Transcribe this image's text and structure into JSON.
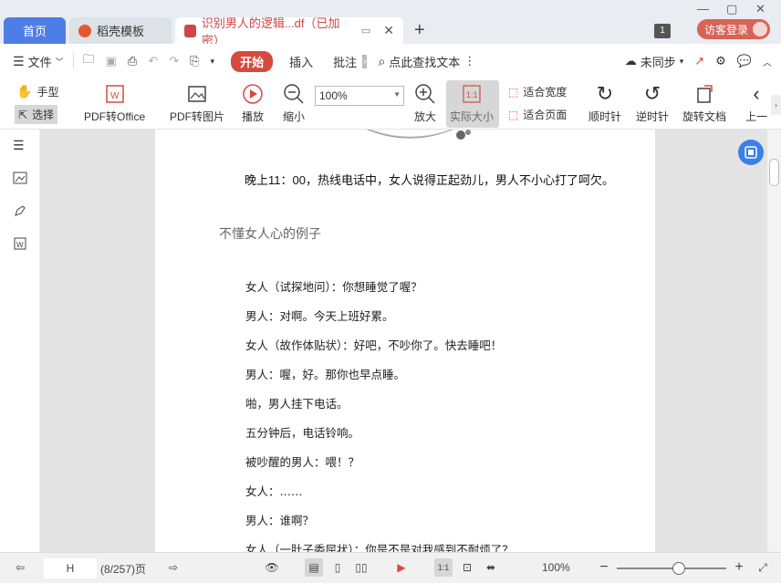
{
  "tabs": {
    "home": "首页",
    "template": "稻壳模板",
    "document": "识别男人的逻辑...df（已加密）",
    "page_count_badge": "1",
    "login": "访客登录"
  },
  "menu": {
    "file": "文件",
    "start": "开始",
    "insert": "插入",
    "annotate": "批注",
    "search": "点此查找文本",
    "sync": "未同步"
  },
  "ribbon": {
    "hand": "手型",
    "select": "选择",
    "pdf_to_office": "PDF转Office",
    "pdf_to_image": "PDF转图片",
    "play": "播放",
    "zoom_out": "缩小",
    "zoom_value": "100%",
    "zoom_in": "放大",
    "actual_size": "实际大小",
    "actual_size_icon": "1:1",
    "fit_width": "适合宽度",
    "fit_page": "适合页面",
    "rotate_cw": "顺时针",
    "rotate_ccw": "逆时针",
    "rotate_doc": "旋转文档",
    "prev": "上一"
  },
  "page": {
    "headline": "晚上11：00，热线电话中，女人说得正起劲儿，男人不小心打了呵欠。",
    "subtitle": "不懂女人心的例子",
    "lines": [
      "女人（试探地问）：你想睡觉了喔？",
      "男人：对啊。今天上班好累。",
      "女人（故作体贴状）：好吧，不吵你了。快去睡吧！",
      "男人：喔，好。那你也早点睡。",
      "啪，男人挂下电话。",
      "五分钟后，电话铃响。",
      "被吵醒的男人：喂！？",
      "女人：……",
      "男人：谁啊？",
      "女人（一肚子委屈状）：你是不是对我感到不耐烦了？"
    ]
  },
  "status": {
    "page_input": "H",
    "page_info": "(8/257)页",
    "zoom": "100%"
  },
  "colors": {
    "accent_blue": "#4e7de6",
    "accent_red": "#d54a3f"
  }
}
